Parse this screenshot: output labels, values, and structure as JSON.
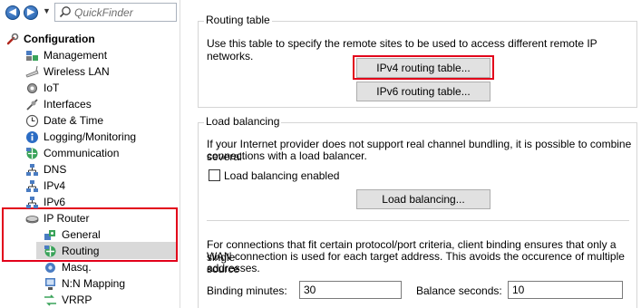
{
  "toolbar": {
    "back_label": "◀",
    "forward_label": "▶",
    "dropdown_label": "▼",
    "quickfinder_placeholder": "QuickFinder"
  },
  "tree": {
    "root": "Configuration",
    "items": [
      {
        "label": "Management"
      },
      {
        "label": "Wireless LAN"
      },
      {
        "label": "IoT"
      },
      {
        "label": "Interfaces"
      },
      {
        "label": "Date & Time"
      },
      {
        "label": "Logging/Monitoring"
      },
      {
        "label": "Communication"
      },
      {
        "label": "DNS"
      },
      {
        "label": "IPv4"
      },
      {
        "label": "IPv6"
      },
      {
        "label": "IP Router"
      },
      {
        "label": "General"
      },
      {
        "label": "Routing"
      },
      {
        "label": "Masq."
      },
      {
        "label": "N:N Mapping"
      },
      {
        "label": "VRRP"
      }
    ]
  },
  "routing_table": {
    "title": "Routing table",
    "description": "Use this table to specify the remote sites to be used to access different remote IP networks.",
    "ipv4_button": "IPv4 routing table...",
    "ipv6_button": "IPv6 routing table..."
  },
  "load_balancing": {
    "title": "Load balancing",
    "description_line1": "If your Internet provider does not support real channel bundling, it is possible to combine several",
    "description_line2": "connections with a load balancer.",
    "checkbox_label": "Load balancing enabled",
    "button": "Load balancing...",
    "binding_line1": "For connections that fit certain protocol/port criteria, client binding ensures that only a single",
    "binding_line2": "WAN connection is used for each target address. This avoids the occurence of multiple source",
    "binding_line3": "addresses.",
    "binding_minutes_label": "Binding minutes:",
    "binding_minutes_value": "30",
    "balance_seconds_label": "Balance seconds:",
    "balance_seconds_value": "10"
  },
  "colors": {
    "highlight": "#e2001a",
    "selection": "#d9d9d9"
  }
}
